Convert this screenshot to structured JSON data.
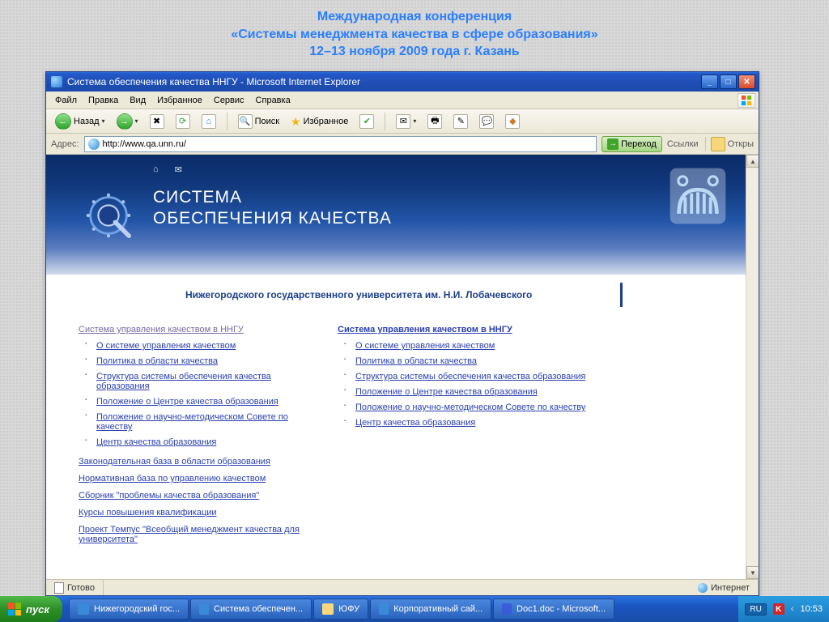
{
  "slide": {
    "line1": "Международная конференция",
    "line2": "«Системы менеджмента качества в сфере образования»",
    "line3": "12–13 ноября 2009 года г. Казань"
  },
  "window": {
    "title": "Система обеспечения качества ННГУ - Microsoft Internet Explorer"
  },
  "menu": {
    "file": "Файл",
    "edit": "Правка",
    "view": "Вид",
    "favorites": "Избранное",
    "tools": "Сервис",
    "help": "Справка"
  },
  "toolbar": {
    "back": "Назад",
    "search": "Поиск",
    "favorites": "Избранное"
  },
  "address": {
    "label": "Адрес:",
    "url": "http://www.qa.unn.ru/",
    "go": "Переход",
    "links": "Ссылки",
    "open": "Откры"
  },
  "banner": {
    "home": "⌂",
    "mail": "✉",
    "line1": "СИСТЕМА",
    "line2": "ОБЕСПЕЧЕНИЯ КАЧЕСТВА",
    "subtitle": "Нижегородского государственного университета им. Н.И. Лобачевского"
  },
  "left": {
    "heading": "Система управления качеством в ННГУ",
    "items": [
      "О системе управления качеством",
      "Политика в области качества",
      "Структура системы обеспечения качества образования",
      "Положение о Центре качества образования",
      "Положение о научно-методическом Совете по качеству",
      "Центр качества образования"
    ],
    "more": [
      "Законодательная база в области образования",
      "Нормативная база по управлению качеством",
      "Сборник \"проблемы качества образования\"",
      "Курсы повышения квалификации",
      "Проект Темпус \"Всеобщий менеджмент качества для университета\""
    ]
  },
  "right": {
    "heading": "Система управления качеством в ННГУ",
    "items": [
      "О системе управления качеством",
      "Политика в области качества",
      "Структура системы обеспечения качества образования",
      "Положение о Центре качества образования",
      "Положение о научно-методическом Совете по качеству",
      "Центр качества образования"
    ]
  },
  "status": {
    "ready": "Готово",
    "zone": "Интернет"
  },
  "taskbar": {
    "start": "пуск",
    "btn1": "Нижегородский гос...",
    "btn2": "Система обеспечен...",
    "btn3": "ЮФУ",
    "btn4": "Корпоративный сай...",
    "btn5": "Doc1.doc - Microsoft...",
    "lang": "RU",
    "clock": "10:53"
  }
}
